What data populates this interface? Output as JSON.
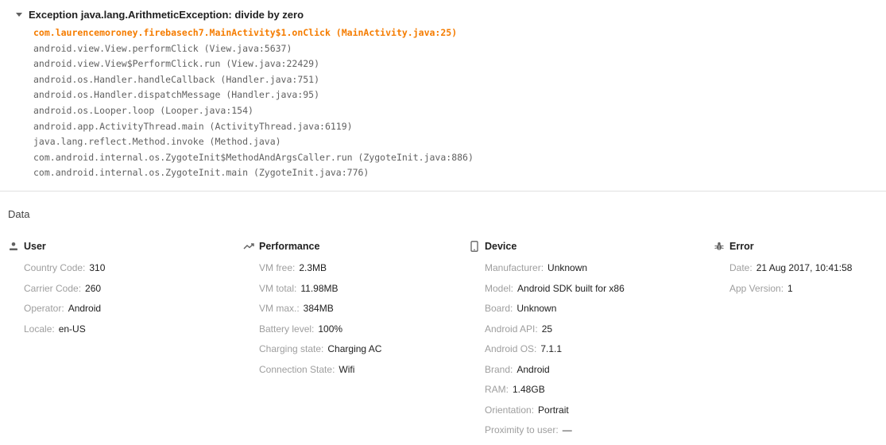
{
  "exception": {
    "title": "Exception java.lang.ArithmeticException: divide by zero",
    "stack": [
      "com.laurencemoroney.firebasech7.MainActivity$1.onClick (MainActivity.java:25)",
      "android.view.View.performClick (View.java:5637)",
      "android.view.View$PerformClick.run (View.java:22429)",
      "android.os.Handler.handleCallback (Handler.java:751)",
      "android.os.Handler.dispatchMessage (Handler.java:95)",
      "android.os.Looper.loop (Looper.java:154)",
      "android.app.ActivityThread.main (ActivityThread.java:6119)",
      "java.lang.reflect.Method.invoke (Method.java)",
      "com.android.internal.os.ZygoteInit$MethodAndArgsCaller.run (ZygoteInit.java:886)",
      "com.android.internal.os.ZygoteInit.main (ZygoteInit.java:776)"
    ]
  },
  "data_section": {
    "title": "Data"
  },
  "user": {
    "title": "User",
    "icon": "person-icon",
    "rows": [
      {
        "label": "Country Code:",
        "value": "310"
      },
      {
        "label": "Carrier Code:",
        "value": "260"
      },
      {
        "label": "Operator:",
        "value": "Android"
      },
      {
        "label": "Locale:",
        "value": "en-US"
      }
    ]
  },
  "performance": {
    "title": "Performance",
    "icon": "trending-icon",
    "rows": [
      {
        "label": "VM free:",
        "value": "2.3MB"
      },
      {
        "label": "VM total:",
        "value": "11.98MB"
      },
      {
        "label": "VM max.:",
        "value": "384MB"
      },
      {
        "label": "Battery level:",
        "value": "100%"
      },
      {
        "label": "Charging state:",
        "value": "Charging AC"
      },
      {
        "label": "Connection State:",
        "value": "Wifi"
      }
    ]
  },
  "device": {
    "title": "Device",
    "icon": "phone-icon",
    "rows": [
      {
        "label": "Manufacturer:",
        "value": "Unknown"
      },
      {
        "label": "Model:",
        "value": "Android SDK built for x86"
      },
      {
        "label": "Board:",
        "value": "Unknown"
      },
      {
        "label": "Android API:",
        "value": "25"
      },
      {
        "label": "Android OS:",
        "value": "7.1.1"
      },
      {
        "label": "Brand:",
        "value": "Android"
      },
      {
        "label": "RAM:",
        "value": "1.48GB"
      },
      {
        "label": "Orientation:",
        "value": "Portrait"
      },
      {
        "label": "Proximity to user:",
        "value": "—"
      }
    ]
  },
  "error": {
    "title": "Error",
    "icon": "bug-icon",
    "rows": [
      {
        "label": "Date:",
        "value": "21 Aug 2017, 10:41:58"
      },
      {
        "label": "App Version:",
        "value": "1"
      }
    ]
  },
  "colors": {
    "highlight": "#f57c00",
    "label": "#9e9e9e",
    "value": "#212121",
    "stack": "#616161"
  }
}
